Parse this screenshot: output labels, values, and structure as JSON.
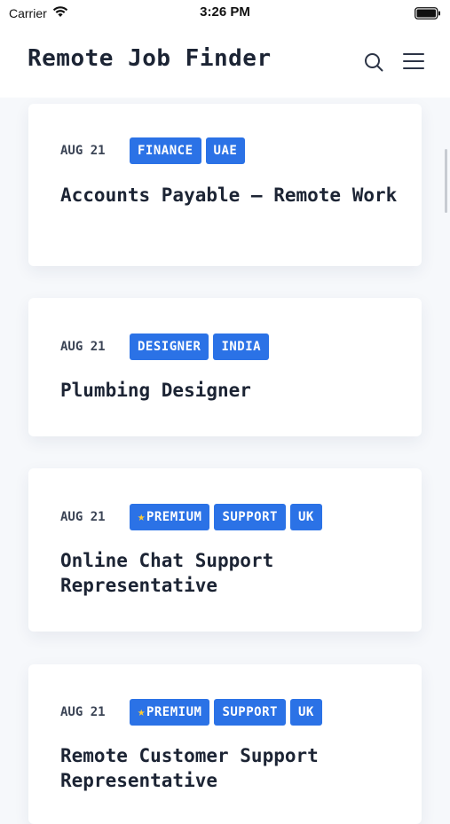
{
  "status_bar": {
    "carrier": "Carrier",
    "time": "3:26 PM"
  },
  "header": {
    "title": "Remote Job Finder"
  },
  "icons": {
    "search": "search-icon",
    "menu": "hamburger-menu-icon",
    "wifi": "wifi-icon",
    "battery": "battery-icon",
    "star": "star-icon"
  },
  "colors": {
    "tag_bg": "#2b72e6",
    "title": "#1c2434",
    "background": "#f6f8fb"
  },
  "jobs": [
    {
      "date": "AUG 21",
      "tags": [
        "FINANCE",
        "UAE"
      ],
      "title": "Accounts Payable – Remote Work"
    },
    {
      "date": "AUG 21",
      "tags": [
        "DESIGNER",
        "INDIA"
      ],
      "title": "Plumbing Designer"
    },
    {
      "date": "AUG 21",
      "premium_label": "PREMIUM",
      "tags": [
        "SUPPORT",
        "UK"
      ],
      "title": "Online Chat Support Representative"
    },
    {
      "date": "AUG 21",
      "premium_label": "PREMIUM",
      "tags": [
        "SUPPORT",
        "UK"
      ],
      "title": "Remote Customer Support Representative"
    }
  ]
}
